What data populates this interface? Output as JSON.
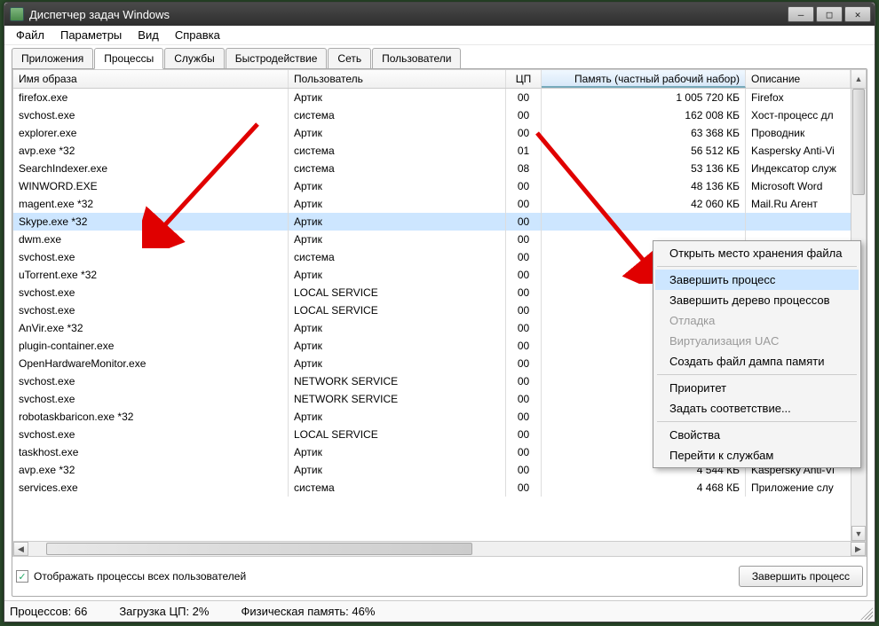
{
  "title": "Диспетчер задач Windows",
  "menu": {
    "file": "Файл",
    "options": "Параметры",
    "view": "Вид",
    "help": "Справка"
  },
  "tabs": {
    "apps": "Приложения",
    "processes": "Процессы",
    "services": "Службы",
    "performance": "Быстродействие",
    "network": "Сеть",
    "users": "Пользователи"
  },
  "columns": {
    "image": "Имя образа",
    "user": "Пользователь",
    "cpu": "ЦП",
    "memory": "Память (частный рабочий набор)",
    "description": "Описание"
  },
  "rows": [
    {
      "img": "firefox.exe",
      "user": "Артик",
      "cpu": "00",
      "mem": "1 005 720 КБ",
      "desc": "Firefox"
    },
    {
      "img": "svchost.exe",
      "user": "система",
      "cpu": "00",
      "mem": "162 008 КБ",
      "desc": "Хост-процесс дл"
    },
    {
      "img": "explorer.exe",
      "user": "Артик",
      "cpu": "00",
      "mem": "63 368 КБ",
      "desc": "Проводник"
    },
    {
      "img": "avp.exe *32",
      "user": "система",
      "cpu": "01",
      "mem": "56 512 КБ",
      "desc": "Kaspersky Anti-Vi"
    },
    {
      "img": "SearchIndexer.exe",
      "user": "система",
      "cpu": "08",
      "mem": "53 136 КБ",
      "desc": "Индексатор служ"
    },
    {
      "img": "WINWORD.EXE",
      "user": "Артик",
      "cpu": "00",
      "mem": "48 136 КБ",
      "desc": "Microsoft Word"
    },
    {
      "img": "magent.exe *32",
      "user": "Артик",
      "cpu": "00",
      "mem": "42 060 КБ",
      "desc": "Mail.Ru Агент"
    },
    {
      "img": "Skype.exe *32",
      "user": "Артик",
      "cpu": "00",
      "mem": "",
      "desc": "",
      "selected": true
    },
    {
      "img": "dwm.exe",
      "user": "Артик",
      "cpu": "00",
      "mem": "",
      "desc": ""
    },
    {
      "img": "svchost.exe",
      "user": "система",
      "cpu": "00",
      "mem": "",
      "desc": ""
    },
    {
      "img": "uTorrent.exe *32",
      "user": "Артик",
      "cpu": "00",
      "mem": "",
      "desc": ""
    },
    {
      "img": "svchost.exe",
      "user": "LOCAL SERVICE",
      "cpu": "00",
      "mem": "",
      "desc": ""
    },
    {
      "img": "svchost.exe",
      "user": "LOCAL SERVICE",
      "cpu": "00",
      "mem": "",
      "desc": ""
    },
    {
      "img": "AnVir.exe *32",
      "user": "Артик",
      "cpu": "00",
      "mem": "",
      "desc": ""
    },
    {
      "img": "plugin-container.exe",
      "user": "Артик",
      "cpu": "00",
      "mem": "",
      "desc": ""
    },
    {
      "img": "OpenHardwareMonitor.exe",
      "user": "Артик",
      "cpu": "00",
      "mem": "",
      "desc": ""
    },
    {
      "img": "svchost.exe",
      "user": "NETWORK SERVICE",
      "cpu": "00",
      "mem": "",
      "desc": ""
    },
    {
      "img": "svchost.exe",
      "user": "NETWORK SERVICE",
      "cpu": "00",
      "mem": "",
      "desc": ""
    },
    {
      "img": "robotaskbaricon.exe *32",
      "user": "Артик",
      "cpu": "00",
      "mem": "",
      "desc": ""
    },
    {
      "img": "svchost.exe",
      "user": "LOCAL SERVICE",
      "cpu": "00",
      "mem": "",
      "desc": ""
    },
    {
      "img": "taskhost.exe",
      "user": "Артик",
      "cpu": "00",
      "mem": "",
      "desc": ""
    },
    {
      "img": "avp.exe *32",
      "user": "Артик",
      "cpu": "00",
      "mem": "4 544 КБ",
      "desc": "Kaspersky Anti-Vi"
    },
    {
      "img": "services.exe",
      "user": "система",
      "cpu": "00",
      "mem": "4 468 КБ",
      "desc": "Приложение слу"
    }
  ],
  "context_menu": {
    "open_location": "Открыть место хранения файла",
    "end_process": "Завершить процесс",
    "end_tree": "Завершить дерево процессов",
    "debug": "Отладка",
    "uac": "Виртуализация UAC",
    "dump": "Создать файл дампа памяти",
    "priority": "Приоритет",
    "affinity": "Задать соответствие...",
    "properties": "Свойства",
    "goto_services": "Перейти к службам"
  },
  "show_all_label": "Отображать процессы всех пользователей",
  "end_process_btn": "Завершить процесс",
  "status": {
    "processes": "Процессов: 66",
    "cpu": "Загрузка ЦП: 2%",
    "mem": "Физическая память: 46%"
  }
}
